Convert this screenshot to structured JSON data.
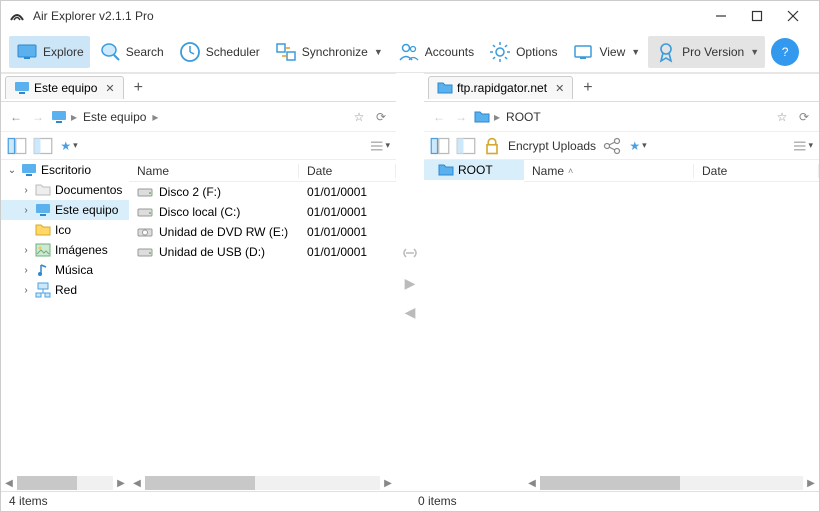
{
  "window": {
    "title": "Air Explorer v2.1.1 Pro"
  },
  "toolbar": {
    "explore": "Explore",
    "search": "Search",
    "scheduler": "Scheduler",
    "synchronize": "Synchronize",
    "accounts": "Accounts",
    "options": "Options",
    "view": "View",
    "pro": "Pro Version",
    "help": "?"
  },
  "left": {
    "tab": "Este equipo",
    "breadcrumb": [
      "Este equipo"
    ],
    "tree": [
      {
        "label": "Escritorio",
        "depth": 0,
        "expanded": true,
        "icon": "monitor"
      },
      {
        "label": "Documentos",
        "depth": 1,
        "expanded": false,
        "icon": "folder"
      },
      {
        "label": "Este equipo",
        "depth": 1,
        "expanded": false,
        "icon": "monitor",
        "selected": true
      },
      {
        "label": "Ico",
        "depth": 1,
        "expanded": false,
        "icon": "folder-yellow"
      },
      {
        "label": "Imágenes",
        "depth": 1,
        "expanded": false,
        "icon": "pictures"
      },
      {
        "label": "Música",
        "depth": 1,
        "expanded": false,
        "icon": "music"
      },
      {
        "label": "Red",
        "depth": 1,
        "expanded": false,
        "icon": "network"
      }
    ],
    "cols": {
      "name": "Name",
      "date": "Date"
    },
    "rows": [
      {
        "name": "Disco 2 (F:)",
        "icon": "drive",
        "date": "01/01/0001"
      },
      {
        "name": "Disco local (C:)",
        "icon": "drive",
        "date": "01/01/0001"
      },
      {
        "name": "Unidad de DVD RW (E:)",
        "icon": "dvd",
        "date": "01/01/0001"
      },
      {
        "name": "Unidad de USB (D:)",
        "icon": "drive",
        "date": "01/01/0001"
      }
    ],
    "status": "4 items"
  },
  "right": {
    "tab": "ftp.rapidgator.net",
    "breadcrumb": [
      "ROOT"
    ],
    "encrypt": "Encrypt Uploads",
    "cols": {
      "name": "Name",
      "date": "Date"
    },
    "side_root": "ROOT",
    "status": "0 items"
  }
}
